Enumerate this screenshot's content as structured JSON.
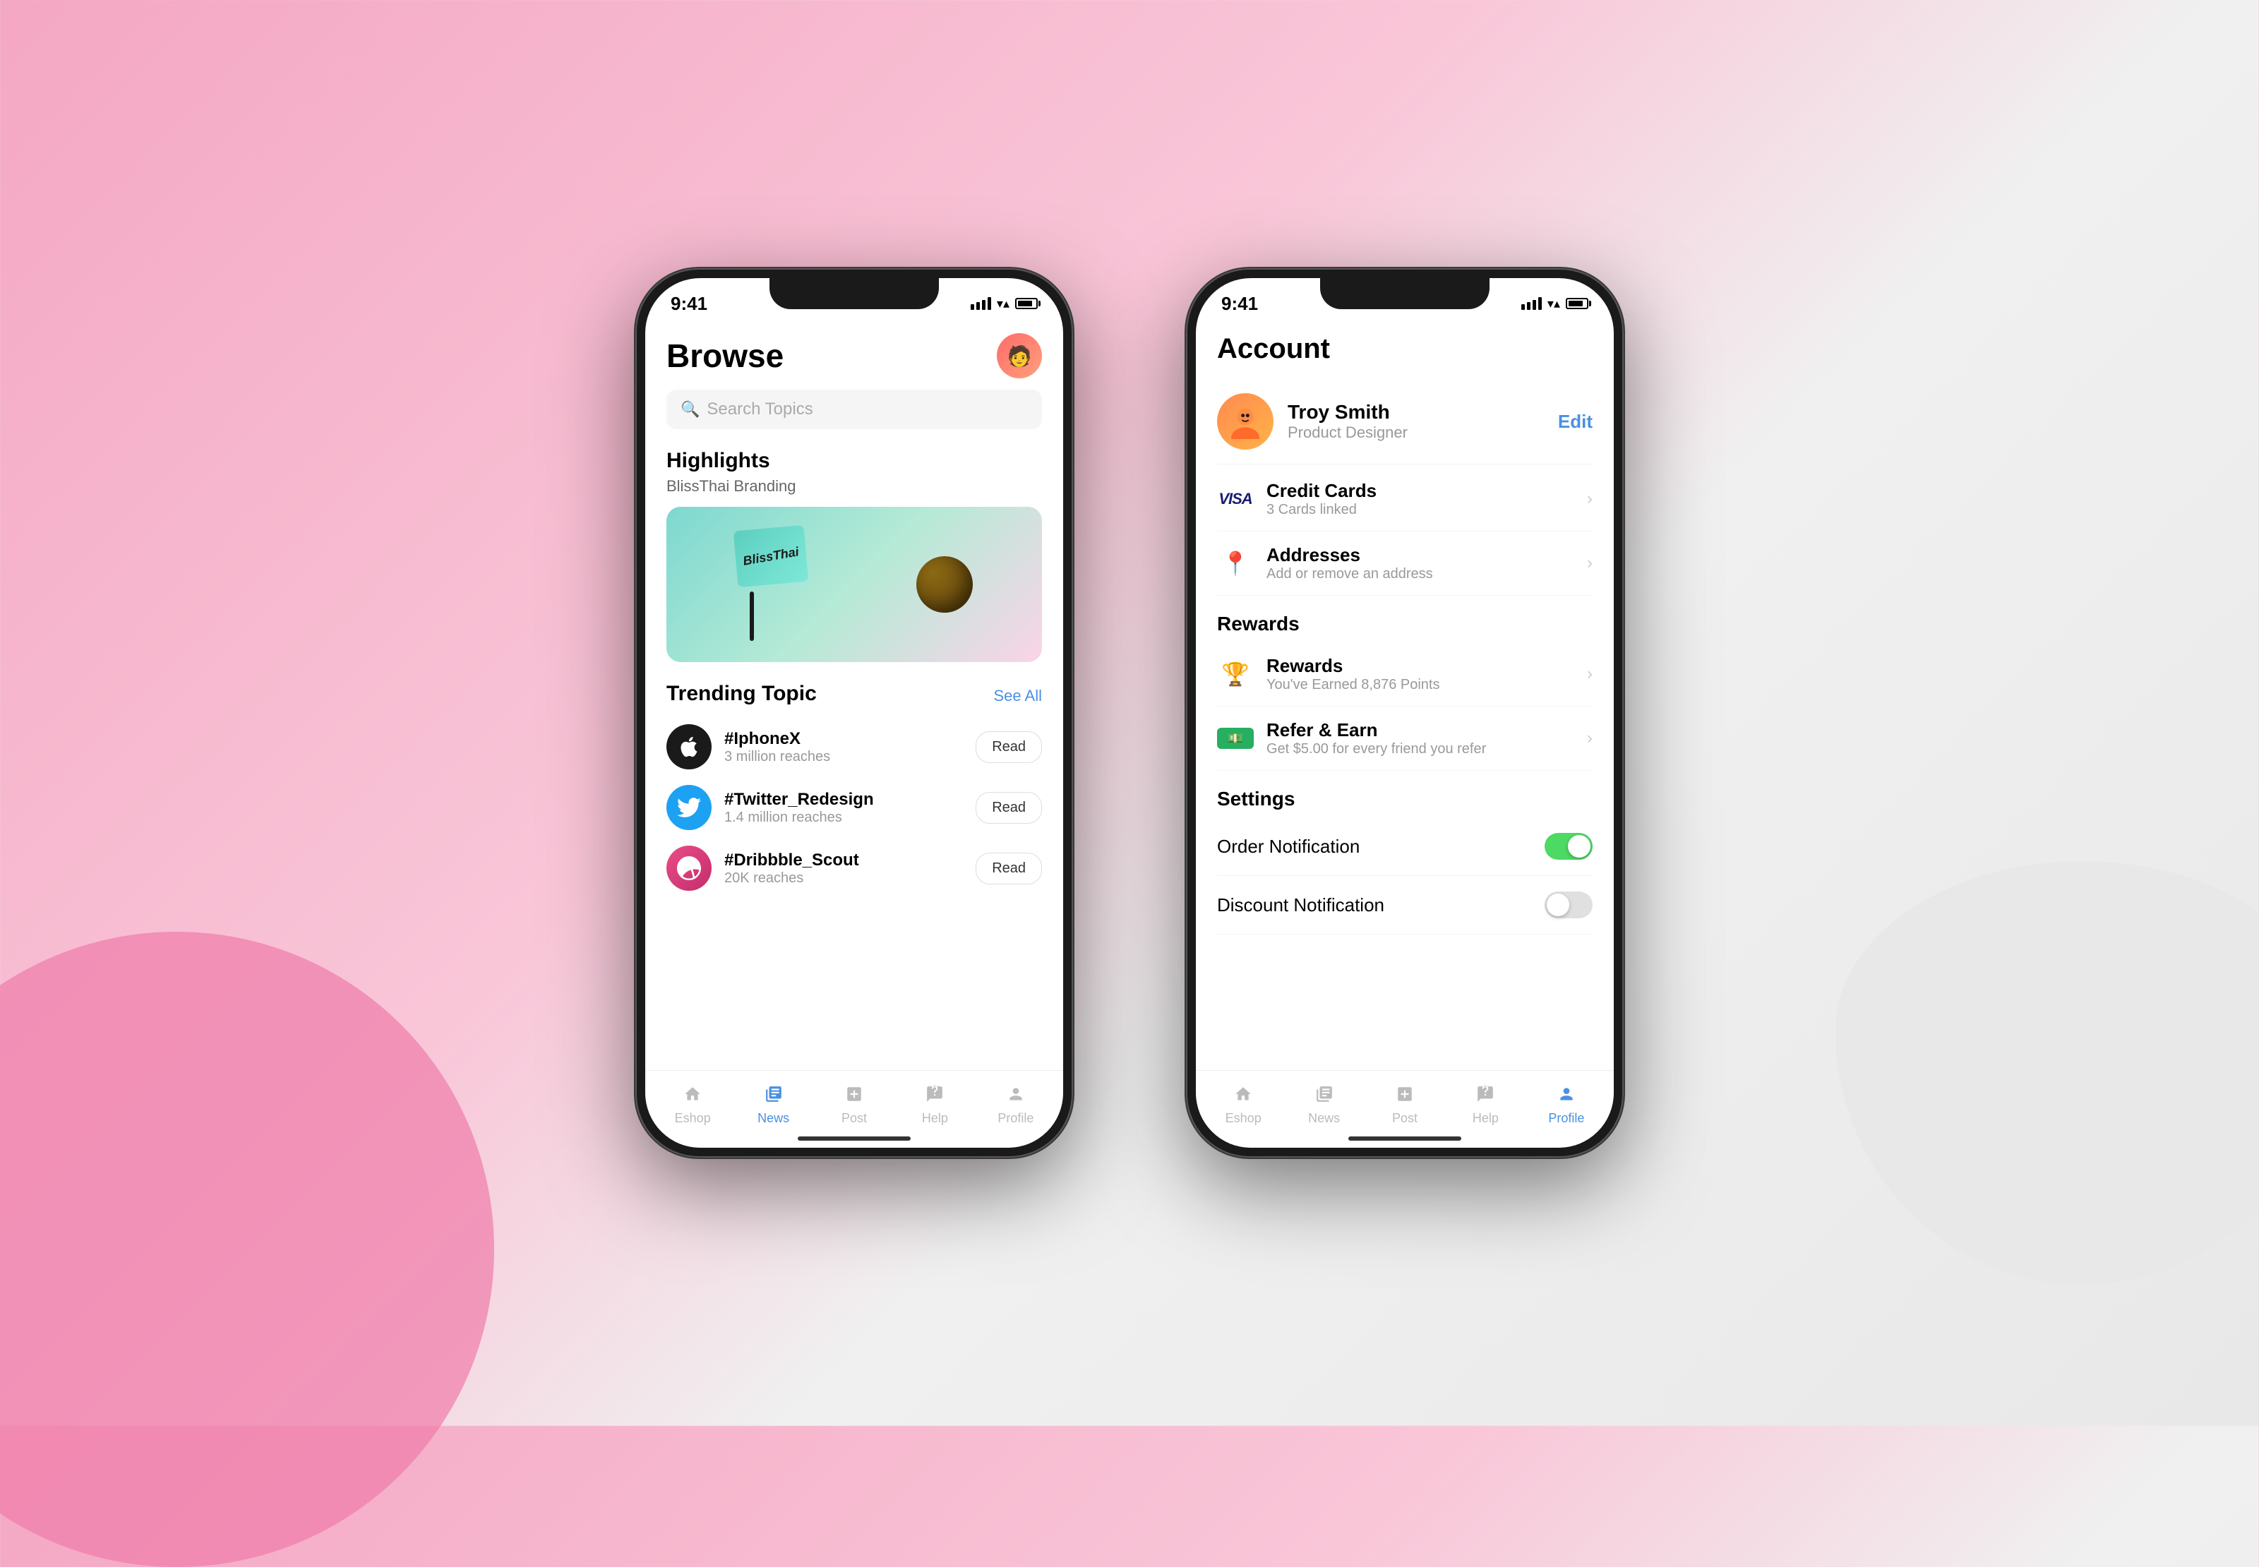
{
  "background": {
    "color_left": "#f4a7c3",
    "color_right": "#e8e8e8"
  },
  "phone_browse": {
    "status_bar": {
      "time": "9:41"
    },
    "header": {
      "title": "Browse",
      "avatar_emoji": "👤"
    },
    "search": {
      "placeholder": "Search Topics"
    },
    "highlights": {
      "title": "Highlights",
      "subtitle": "BlissThai Branding",
      "card_text": "BlissThai"
    },
    "trending": {
      "title": "Trending Topic",
      "see_all": "See All",
      "items": [
        {
          "name": "#IphoneX",
          "reaches": "3 million reaches",
          "icon_type": "apple",
          "icon_symbol": ""
        },
        {
          "name": "#Twitter_Redesign",
          "reaches": "1.4 million reaches",
          "icon_type": "twitter",
          "icon_symbol": "🐦"
        },
        {
          "name": "#Dribbble_Scout",
          "reaches": "20K reaches",
          "icon_type": "dribbble",
          "icon_symbol": "🏀"
        }
      ],
      "read_label": "Read"
    },
    "tab_bar": {
      "items": [
        {
          "label": "Eshop",
          "icon": "🛒",
          "active": false
        },
        {
          "label": "News",
          "icon": "📰",
          "active": true
        },
        {
          "label": "Post",
          "icon": "➕",
          "active": false
        },
        {
          "label": "Help",
          "icon": "💬",
          "active": false
        },
        {
          "label": "Profile",
          "icon": "👤",
          "active": false
        }
      ]
    }
  },
  "phone_account": {
    "status_bar": {
      "time": "9:41"
    },
    "header": {
      "title": "Account"
    },
    "profile": {
      "name": "Troy Smith",
      "role": "Product Designer",
      "edit_label": "Edit",
      "avatar_emoji": "👤"
    },
    "sections": {
      "account": {
        "items": [
          {
            "id": "credit-cards",
            "title": "Credit Cards",
            "subtitle": "3 Cards linked",
            "icon_type": "visa"
          },
          {
            "id": "addresses",
            "title": "Addresses",
            "subtitle": "Add or remove an address",
            "icon_type": "location"
          }
        ]
      },
      "rewards": {
        "title": "Rewards",
        "items": [
          {
            "id": "rewards",
            "title": "Rewards",
            "subtitle": "You've Earned 8,876 Points",
            "icon_type": "trophy"
          },
          {
            "id": "refer",
            "title": "Refer & Earn",
            "subtitle": "Get $5.00 for every friend you refer",
            "icon_type": "refer"
          }
        ]
      },
      "settings": {
        "title": "Settings",
        "items": [
          {
            "id": "order-notification",
            "label": "Order Notification",
            "enabled": true
          },
          {
            "id": "discount-notification",
            "label": "Discount Notification",
            "enabled": false
          }
        ]
      }
    },
    "tab_bar": {
      "items": [
        {
          "label": "Eshop",
          "icon": "🛒",
          "active": false
        },
        {
          "label": "News",
          "icon": "📰",
          "active": false
        },
        {
          "label": "Post",
          "icon": "➕",
          "active": false
        },
        {
          "label": "Help",
          "icon": "💬",
          "active": false
        },
        {
          "label": "Profile",
          "icon": "👤",
          "active": true
        }
      ]
    }
  }
}
